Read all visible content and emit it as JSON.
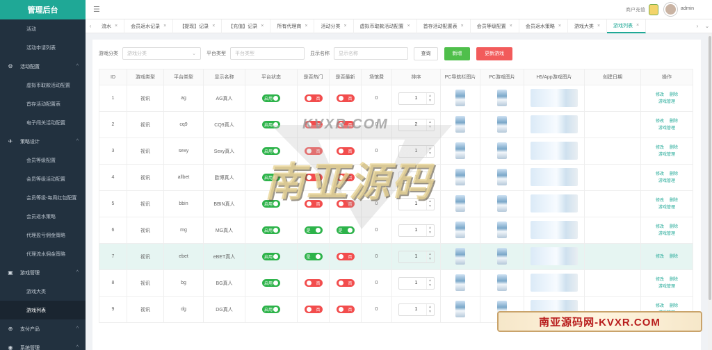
{
  "app": {
    "title": "管理后台"
  },
  "sidebar": {
    "items": [
      {
        "label": "活动",
        "type": "item"
      },
      {
        "label": "活动申请列表",
        "type": "item"
      },
      {
        "label": "活动配置",
        "type": "group"
      },
      {
        "label": "虚拟币取款活动配置",
        "type": "item"
      },
      {
        "label": "首存活动配置表",
        "type": "item"
      },
      {
        "label": "电子闯关活动配置",
        "type": "item"
      },
      {
        "label": "策略设计",
        "type": "group"
      },
      {
        "label": "会员等级配置",
        "type": "item"
      },
      {
        "label": "会员等级活动配置",
        "type": "item"
      },
      {
        "label": "会员等级-每周红包配置",
        "type": "item"
      },
      {
        "label": "会员返水策略",
        "type": "item"
      },
      {
        "label": "代理盈亏佣金策略",
        "type": "item"
      },
      {
        "label": "代理流水佣金策略",
        "type": "item"
      },
      {
        "label": "游戏管理",
        "type": "group"
      },
      {
        "label": "游戏大类",
        "type": "item"
      },
      {
        "label": "游戏列表",
        "type": "item",
        "active": true
      },
      {
        "label": "支付产品",
        "type": "group"
      },
      {
        "label": "系统管理",
        "type": "group"
      }
    ]
  },
  "header": {
    "merchant_label": "商户充值",
    "username": "admin"
  },
  "tabs": [
    {
      "label": "流水"
    },
    {
      "label": "会员返水记录"
    },
    {
      "label": "【提现】记录"
    },
    {
      "label": "【充值】记录"
    },
    {
      "label": "所有代理商"
    },
    {
      "label": "活动分类"
    },
    {
      "label": "虚拟币取款活动配置"
    },
    {
      "label": "首存活动配置表"
    },
    {
      "label": "会员等级配置"
    },
    {
      "label": "会员返水策略"
    },
    {
      "label": "游戏大类"
    },
    {
      "label": "游戏列表",
      "active": true
    }
  ],
  "filters": {
    "category_label": "游戏分类",
    "category_placeholder": "游戏分类",
    "platform_label": "平台类型",
    "platform_placeholder": "平台类型",
    "name_label": "显示名称",
    "name_placeholder": "显示名称",
    "search_button": "查询",
    "add_button": "新增",
    "update_button": "更新游戏"
  },
  "table": {
    "columns": [
      "ID",
      "游戏类型",
      "平台类型",
      "显示名称",
      "平台状态",
      "是否热门",
      "是否最新",
      "场馆费",
      "排序",
      "PC导航栏图片",
      "PC游戏图片",
      "H5/App游戏图片",
      "创建日期",
      "操作"
    ],
    "switch_on_label": "启用",
    "yes_label": "是",
    "no_label": "否",
    "edit_label": "修改",
    "delete_label": "删除",
    "manage_label": "游戏管理",
    "rows": [
      {
        "id": "1",
        "type": "视讯",
        "platform": "ag",
        "name": "AG真人",
        "status": true,
        "hot": false,
        "new": false,
        "fee": "0",
        "sort": "1",
        "manage": true
      },
      {
        "id": "2",
        "type": "视讯",
        "platform": "cq9",
        "name": "CQ9真人",
        "status": true,
        "hot": false,
        "new": false,
        "fee": "0",
        "sort": "2",
        "manage": true
      },
      {
        "id": "3",
        "type": "视讯",
        "platform": "sexy",
        "name": "Sexy真人",
        "status": true,
        "hot": false,
        "new": false,
        "fee": "0",
        "sort": "1",
        "manage": true
      },
      {
        "id": "4",
        "type": "视讯",
        "platform": "allbet",
        "name": "欧博真人",
        "status": true,
        "hot": false,
        "new": false,
        "fee": "0",
        "sort": "1",
        "manage": true
      },
      {
        "id": "5",
        "type": "视讯",
        "platform": "bbin",
        "name": "BBIN真人",
        "status": true,
        "hot": false,
        "new": false,
        "fee": "0",
        "sort": "1",
        "manage": true
      },
      {
        "id": "6",
        "type": "视讯",
        "platform": "mg",
        "name": "MG真人",
        "status": true,
        "hot": true,
        "new": true,
        "fee": "0",
        "sort": "1",
        "manage": true
      },
      {
        "id": "7",
        "type": "视讯",
        "platform": "ebet",
        "name": "eBET真人",
        "status": true,
        "hot": true,
        "new": false,
        "fee": "0",
        "sort": "1",
        "manage": false
      },
      {
        "id": "8",
        "type": "视讯",
        "platform": "bg",
        "name": "BG真人",
        "status": true,
        "hot": false,
        "new": false,
        "fee": "0",
        "sort": "1",
        "manage": true
      },
      {
        "id": "9",
        "type": "视讯",
        "platform": "dg",
        "name": "DG真人",
        "status": true,
        "hot": false,
        "new": false,
        "fee": "0",
        "sort": "1",
        "manage": true
      }
    ]
  },
  "watermark": {
    "banner": "南亚源码网-KVXR.COM",
    "big_top": "KVXR.COM",
    "big_main": "南亚源码"
  }
}
